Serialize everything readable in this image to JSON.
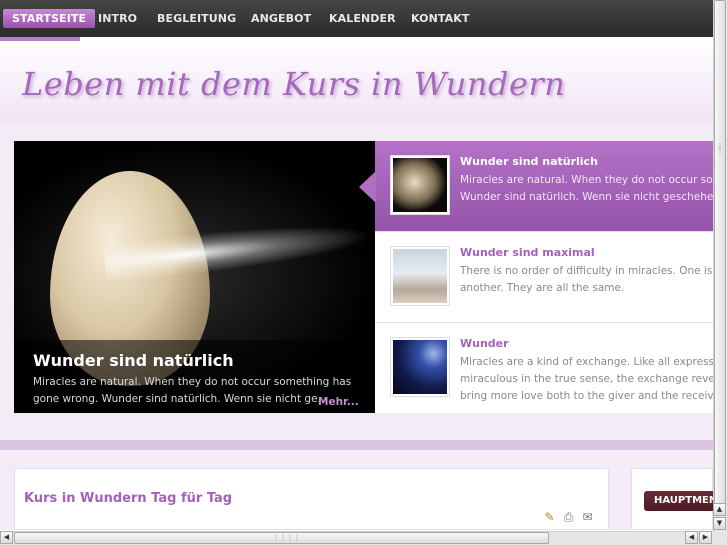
{
  "nav": {
    "items": [
      {
        "label": "STARTSEITE",
        "active": true
      },
      {
        "label": "INTRO"
      },
      {
        "label": "BEGLEITUNG"
      },
      {
        "label": "ANGEBOT"
      },
      {
        "label": "KALENDER"
      },
      {
        "label": "KONTAKT"
      }
    ]
  },
  "header": {
    "title": "Leben mit dem Kurs in Wundern"
  },
  "slider": {
    "main": {
      "title": "Wunder sind natürlich",
      "text": "Miracles are natural. When they do not occur something has gone wrong.   Wunder sind natürlich. Wenn sie nicht ge...",
      "more": "Mehr..."
    },
    "items": [
      {
        "title": "Wunder sind natürlich",
        "text_line1": "Miracles are natural. When they do not occur somet",
        "text_line2": "Wunder sind natürlich. Wenn sie nicht geschehen, i",
        "active": true
      },
      {
        "title": "Wunder sind maximal",
        "text_line1": "There is no order of difficulty in miracles. One is not",
        "text_line2": "another. They are all the same."
      },
      {
        "title": "Wunder",
        "text_line1": "Miracles are a kind of exchange. Like all expression",
        "text_line2": "miraculous in the true sense, the exchange reverse",
        "text_line3": "bring more love both to the giver and the receiver. W"
      }
    ]
  },
  "article": {
    "title": "Kurs in Wundern Tag für Tag",
    "icons": [
      "edit-icon",
      "print-icon",
      "email-icon"
    ]
  },
  "sidebar": {
    "menu_label": "HAUPTMENÜ"
  },
  "colors": {
    "accent": "#a660ba",
    "nav_bg": "#333333",
    "menu_button": "#5c2230"
  }
}
